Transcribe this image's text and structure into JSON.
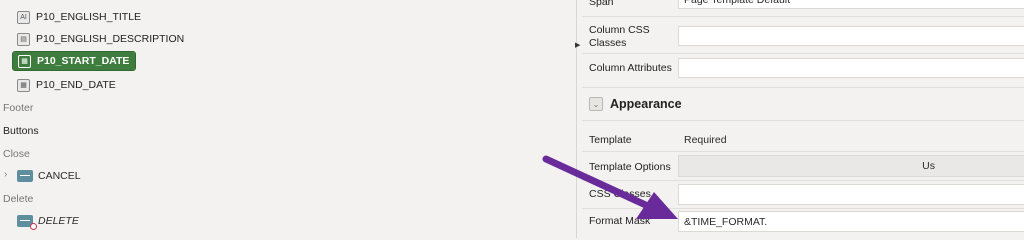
{
  "tree": {
    "items": [
      {
        "label": "P10_ENGLISH_TITLE",
        "icon": "text-field-icon"
      },
      {
        "label": "P10_ENGLISH_DESCRIPTION",
        "icon": "textarea-icon"
      },
      {
        "label": "P10_START_DATE",
        "icon": "calendar-icon"
      },
      {
        "label": "P10_END_DATE",
        "icon": "calendar-icon"
      }
    ],
    "footer": "Footer",
    "buttons": "Buttons",
    "close_group": "Close",
    "cancel_label": "CANCEL",
    "delete_group": "Delete",
    "delete_label": "DELETE"
  },
  "props": {
    "span_label": "Span",
    "span_value": "Page Template Default",
    "column_css_label": "Column CSS Classes",
    "column_attr_label": "Column Attributes",
    "appearance_title": "Appearance",
    "template_label": "Template",
    "template_value": "Required",
    "template_options_label": "Template Options",
    "template_options_value": "Us",
    "css_classes_label": "CSS Classes",
    "format_mask_label": "Format Mask",
    "format_mask_value": "&TIME_FORMAT."
  },
  "colors": {
    "selected_bg": "#3e7d3e",
    "annotation_arrow": "#6a2b9a"
  }
}
